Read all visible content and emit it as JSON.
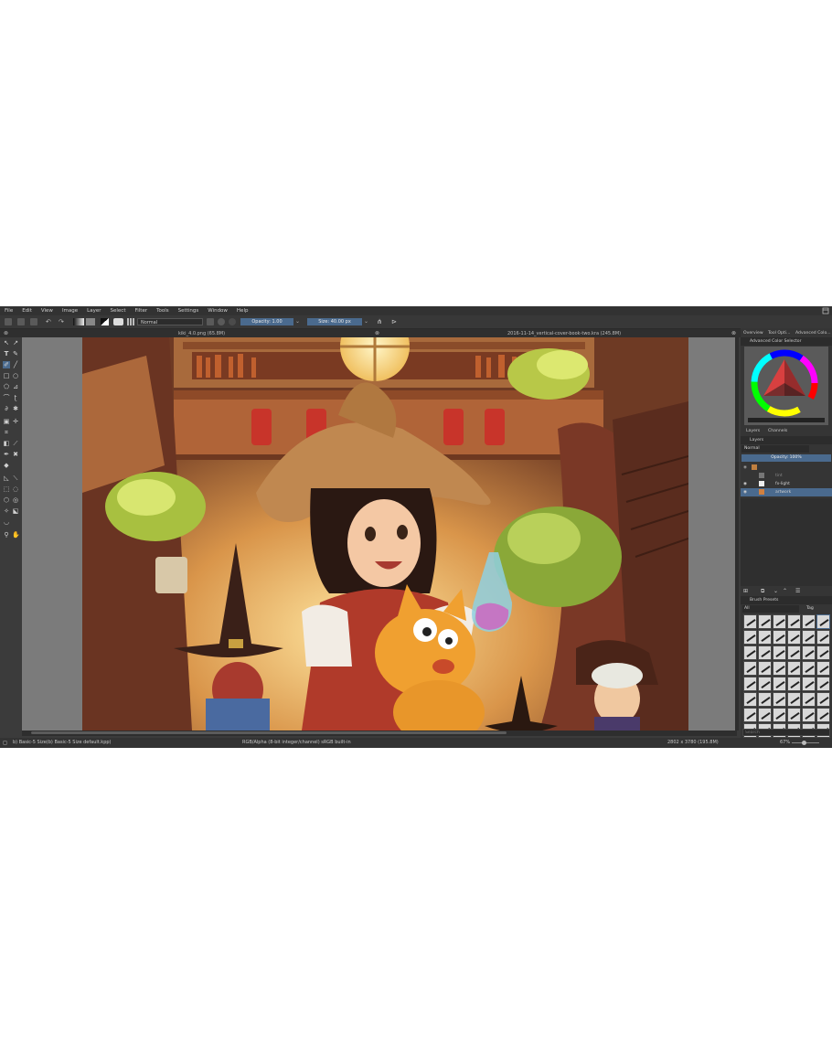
{
  "menu": {
    "items": [
      "File",
      "Edit",
      "View",
      "Image",
      "Layer",
      "Select",
      "Filter",
      "Tools",
      "Settings",
      "Window",
      "Help"
    ]
  },
  "toolbar": {
    "blend_mode": "Normal",
    "opacity_label": "Opacity:  1.00",
    "size_label": "Size:  40.00 px"
  },
  "tabs": {
    "doc1": "kiki_4.0.png (65.8M)",
    "doc2": "2016-11-14_vertical-cover-book-two.kra (245.8M)"
  },
  "dock": {
    "top_tabs": [
      "Overview",
      "Tool Opti...",
      "Advanced Colo..."
    ],
    "color_selector_title": "Advanced Color Selector",
    "layer_tabs": [
      "Layers",
      "Channels"
    ],
    "layers_title": "Layers",
    "layer_blend": "Normal",
    "layer_opacity": "Opacity:  100%",
    "layers": [
      {
        "name": "tint",
        "visible": false
      },
      {
        "name": "fx-light",
        "visible": true
      },
      {
        "name": "artwork",
        "visible": true,
        "selected": true
      }
    ],
    "brush_presets_title": "Brush Presets",
    "brush_filter": "All",
    "brush_tag": "Tag",
    "search_placeholder": "Search"
  },
  "status": {
    "brush": "b) Basic-5 Size(b) Basic-5 Size default.kpp)",
    "color_model": "RGB/Alpha (8-bit integer/channel)  sRGB built-in",
    "dimensions": "2802 x 3780 (195.8M)",
    "zoom": "67%"
  },
  "colors": {
    "accent": "#4a6a8e",
    "background": "#3b3b3b"
  }
}
